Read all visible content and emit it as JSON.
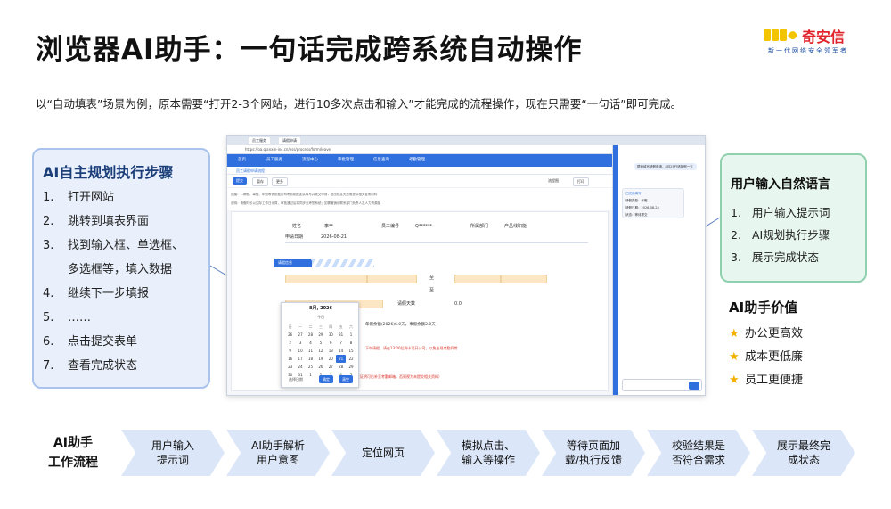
{
  "title": "浏览器AI助手：一句话完成跨系统自动操作",
  "logo": {
    "name": "奇安信",
    "tagline": "新一代网络安全领军者"
  },
  "intro": "以“自动填表”场景为例，原本需要“打开2-3个网站，进行10多次点击和输入”才能完成的流程操作，现在只需要“一句话”即可完成。",
  "steps_panel": {
    "title": "AI自主规划执行步骤",
    "items": [
      {
        "num": "1.",
        "text": "打开网站"
      },
      {
        "num": "2.",
        "text": "跳转到填表界面"
      },
      {
        "num": "3.",
        "text": "找到输入框、单选框、"
      },
      {
        "num": "",
        "text": "多选框等，填入数据"
      },
      {
        "num": "4.",
        "text": "继续下一步填报"
      },
      {
        "num": "5.",
        "text": "……"
      },
      {
        "num": "6.",
        "text": "点击提交表单"
      },
      {
        "num": "7.",
        "text": "查看完成状态"
      }
    ]
  },
  "input_panel": {
    "title": "用户输入自然语言",
    "items": [
      {
        "num": "1.",
        "text": "用户输入提示词"
      },
      {
        "num": "2.",
        "text": "AI规划执行步骤"
      },
      {
        "num": "3.",
        "text": "展示完成状态"
      }
    ]
  },
  "value_panel": {
    "title": "AI助手价值",
    "items": [
      "办公更高效",
      "成本更低廉",
      "员工更便捷"
    ]
  },
  "screenshot": {
    "tabs": [
      "员工服务",
      "请假申请"
    ],
    "url": "https://oa.qianxin-inc.cn/ess/process/form/leave",
    "nav": [
      "首页",
      "员工服务",
      "流程中心",
      "审批管理",
      "信息查询",
      "考勤管理"
    ],
    "subnav": "员工请假申请流程",
    "toolbar": [
      "提交",
      "暂存",
      "更多",
      "流程图",
      "打印"
    ],
    "notice_lines": [
      "提醒：1.病假、事假、年假等请依据公司考勤制度如实填写并提交申请，超出规定天数需提供相关证明材料",
      "说明：请假时长以实际工作日计算，审批通过后将同步至考勤系统；如需撤销请联系部门负责人及人力资源部"
    ],
    "form": {
      "name_label": "姓名",
      "name_value": "李**",
      "emp_label": "员工编号",
      "emp_value": "Q******",
      "dept_label": "所属部门",
      "product_label": "产品线职能",
      "date_label": "申请日期",
      "date_value": "2026-08-21",
      "section": "请假信息",
      "to1": "至",
      "to2": "至",
      "days_label": "请假天数",
      "days_value": "0.0",
      "balance": "年假余额(2026)6.0天，事假余额2.0天",
      "note1": "下午请假，请在13:00后刷卡离开公司，以免出现考勤异常",
      "note2": "产假：生育服务证、诊断证明、出生证明（出生证明可后补至考勤邮箱，否则视为未提交相关资料）"
    },
    "calendar": {
      "month": "8月, 2026",
      "today": "今日",
      "weekdays": [
        "日",
        "一",
        "二",
        "三",
        "四",
        "五",
        "六"
      ],
      "days": [
        "26",
        "27",
        "28",
        "29",
        "30",
        "31",
        "1",
        "2",
        "3",
        "4",
        "5",
        "6",
        "7",
        "8",
        "9",
        "10",
        "11",
        "12",
        "13",
        "14",
        "15",
        "16",
        "17",
        "18",
        "19",
        "20",
        "21",
        "22",
        "23",
        "24",
        "25",
        "26",
        "27",
        "28",
        "29",
        "30",
        "31",
        "1",
        "2",
        "3",
        "4",
        "5"
      ],
      "selected": "21",
      "clear": "选择日期",
      "ok": "确定",
      "cancel": "清空"
    },
    "assistant": {
      "bubble": "帮我填写请假申请，8月25日请年假一天",
      "card_title": "已完成填写",
      "card_line1": "请假类型：年假",
      "card_line2": "请假日期：2026-08-25",
      "card_line3": "状态：等待提交"
    }
  },
  "workflow": {
    "label": "AI助手\n工作流程",
    "steps": [
      "用户输入\n提示词",
      "AI助手解析\n用户意图",
      "定位网页",
      "模拟点击、\n输入等操作",
      "等待页面加\n载/执行反馈",
      "校验结果是\n否符合需求",
      "展示最终完\n成状态"
    ]
  },
  "colors": {
    "accent": "#2f6fde",
    "steps_bg": "#e9f0fb",
    "input_bg": "#e7f6ee",
    "flow_bg": "#dbe6f8",
    "brand": "#e1232b"
  }
}
